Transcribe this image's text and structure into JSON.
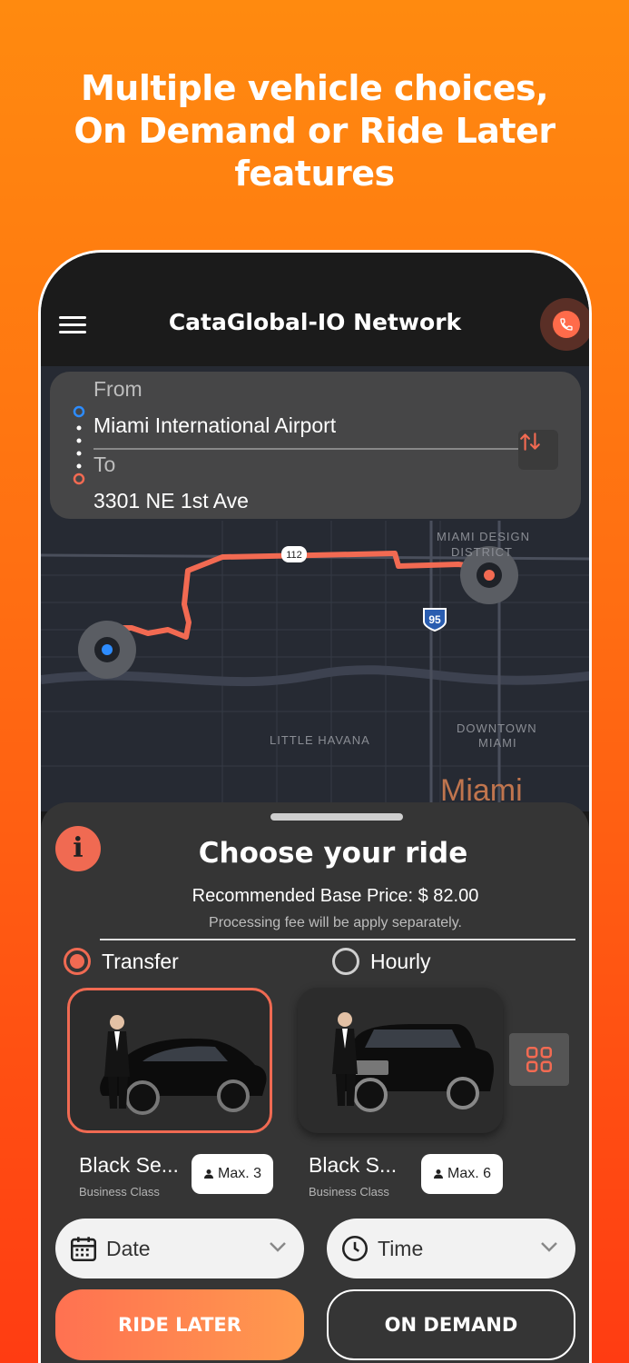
{
  "headline": {
    "line1": "Multiple vehicle choices,",
    "line2": "On Demand or Ride Later",
    "line3": "features"
  },
  "appbar": {
    "title": "CataGlobal-IO Network"
  },
  "route": {
    "from_label": "From",
    "from_value": "Miami International Airport",
    "to_label": "To",
    "to_value": "3301 NE 1st Ave"
  },
  "map": {
    "labels": {
      "design_district": "MIAMI DESIGN",
      "design_district2": "DISTRICT",
      "little_havana": "LITTLE HAVANA",
      "downtown": "DOWNTOWN",
      "downtown2": "MIAMI",
      "city": "Miami",
      "road_112": "112",
      "road_95": "95"
    },
    "route_color": "#f26a52"
  },
  "sheet": {
    "title": "Choose your ride",
    "price": "Recommended Base Price: $ 82.00",
    "fee": "Processing fee will be apply separately.",
    "options": [
      {
        "label": "Transfer",
        "selected": true
      },
      {
        "label": "Hourly",
        "selected": false
      }
    ],
    "vehicles": [
      {
        "name": "Black Se...",
        "class": "Business Class",
        "max": "Max. 3",
        "selected": true
      },
      {
        "name": "Black S...",
        "class": "Business Class",
        "max": "Max. 6",
        "selected": false
      }
    ],
    "date_label": "Date",
    "time_label": "Time",
    "ride_later": "RIDE LATER",
    "on_demand": "ON DEMAND"
  },
  "colors": {
    "accent": "#f06a52",
    "background": "#ff7a12"
  }
}
